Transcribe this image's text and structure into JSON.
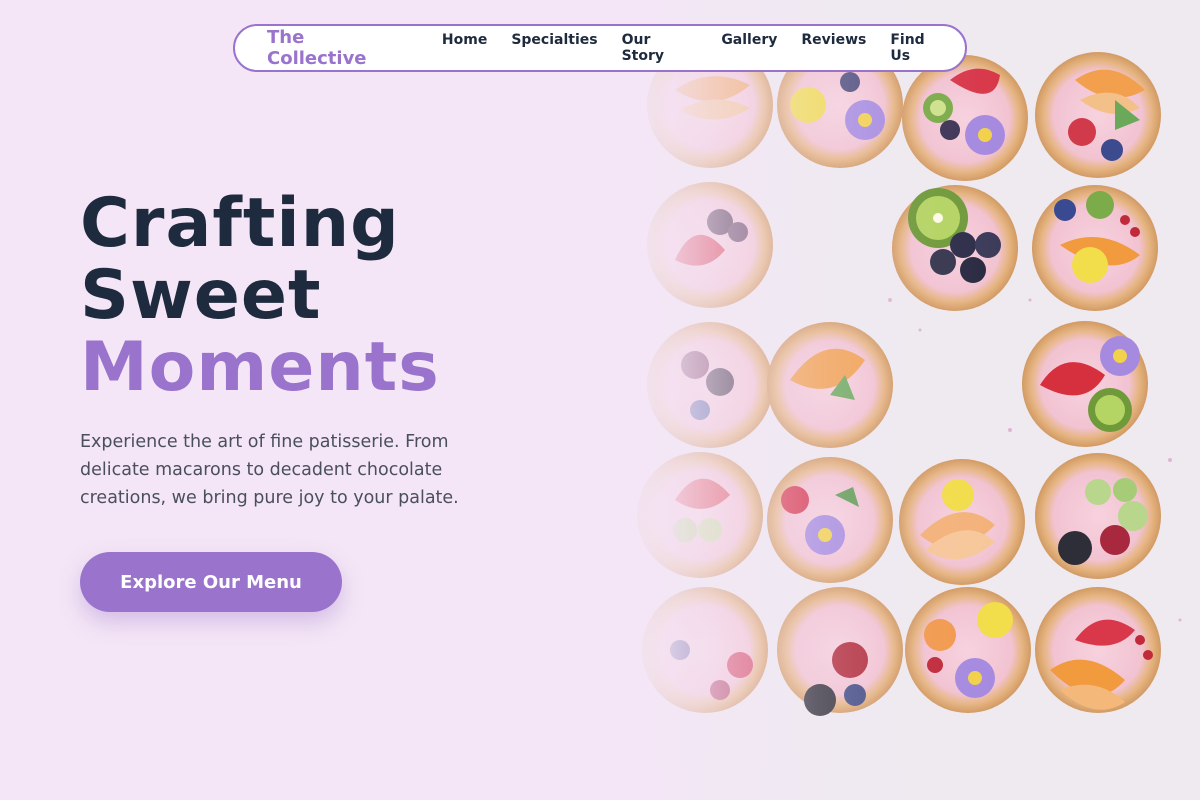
{
  "nav": {
    "brand": "The Collective",
    "links": [
      "Home",
      "Specialties",
      "Our Story",
      "Gallery",
      "Reviews",
      "Find Us"
    ]
  },
  "hero": {
    "headline_line1": "Crafting",
    "headline_line2": "Sweet",
    "headline_accent": "Moments",
    "subtext": "Experience the art of fine patisserie. From delicate macarons to decadent chocolate creations, we bring pure joy to your palate.",
    "cta_label": "Explore Our Menu"
  },
  "colors": {
    "background": "#f4e6f6",
    "accent": "#9a73cc",
    "heading": "#1e2a3d",
    "body_text": "#4a4f5e"
  }
}
